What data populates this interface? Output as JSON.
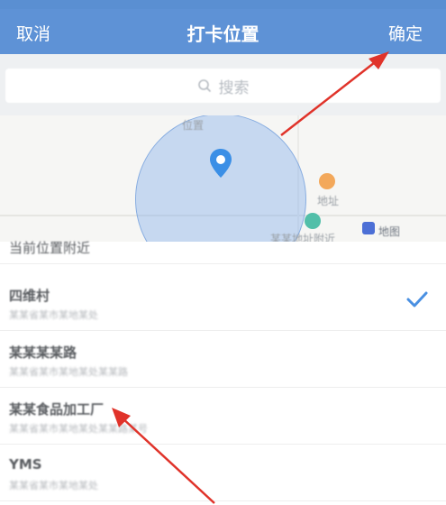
{
  "header": {
    "cancel_label": "取消",
    "title": "打卡位置",
    "confirm_label": "确定"
  },
  "search": {
    "placeholder": "搜索"
  },
  "map": {
    "area_label": "位置",
    "poi_1": "地址",
    "poi_2": "某某地址附近",
    "poi_3": "地图"
  },
  "list": {
    "rows": [
      {
        "name": "当前位置附近",
        "address": ""
      },
      {
        "name": "四维村",
        "address": "某某省某市某地某处",
        "selected": true
      },
      {
        "name": "某某某某路",
        "address": "某某省某市某地某处某某路"
      },
      {
        "name": "某某食品加工厂",
        "address": "某某省某市某地某处某某路某号"
      },
      {
        "name": "YMS",
        "address": "某某省某市某地某处"
      }
    ]
  },
  "colors": {
    "header": "#5e92d6",
    "accent": "#4a90e2",
    "arrow": "#e0332a"
  }
}
